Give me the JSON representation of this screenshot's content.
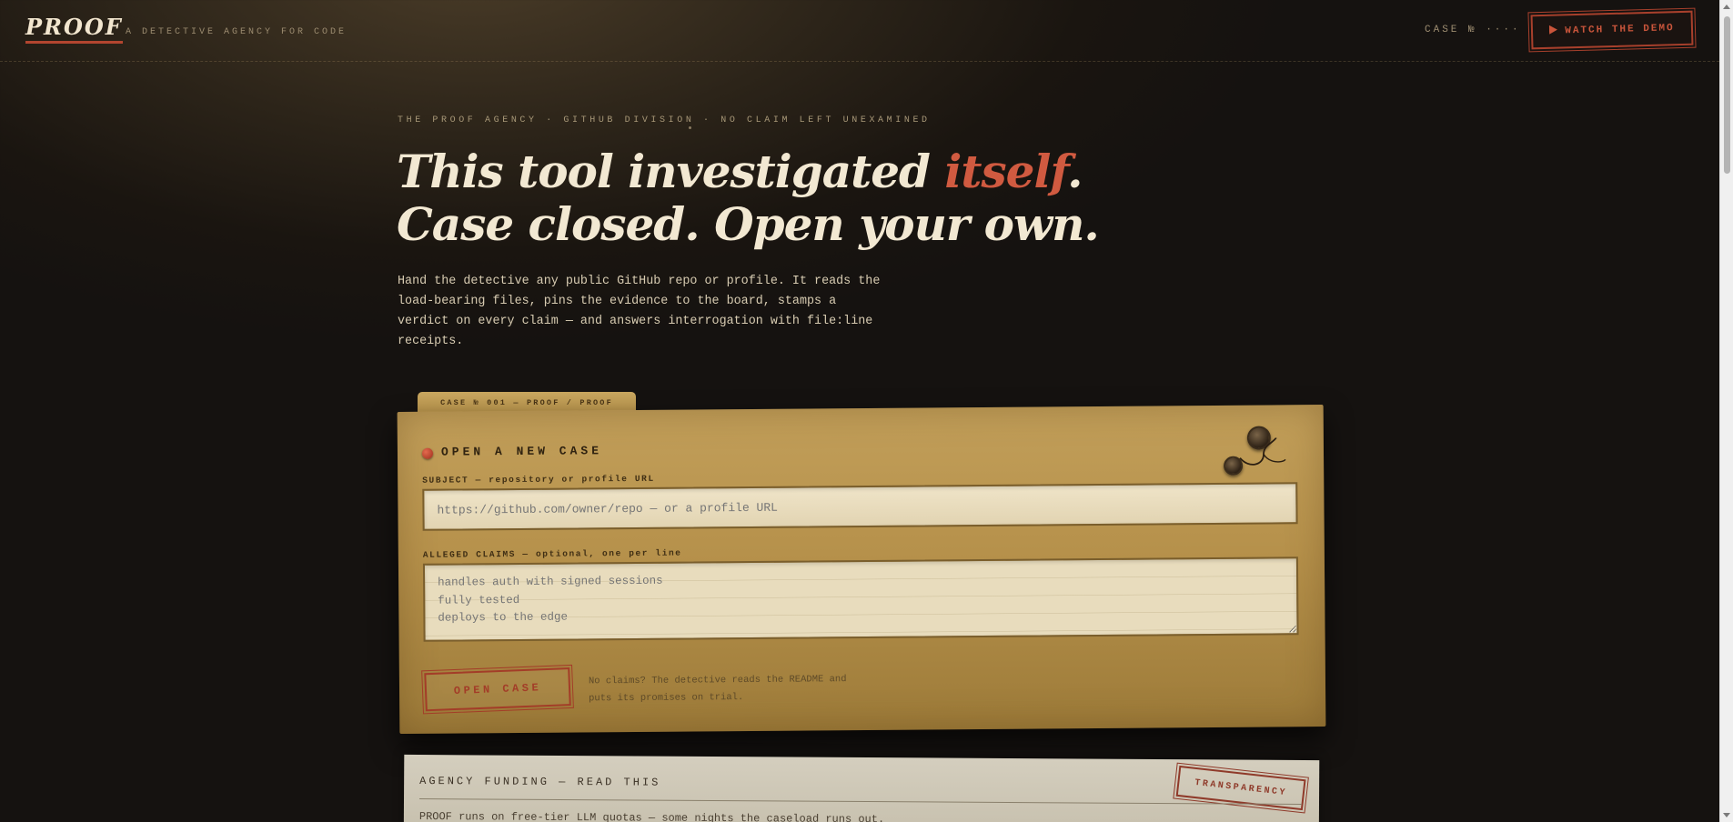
{
  "header": {
    "logo": "PROOF",
    "tagline": "A DETECTIVE AGENCY FOR CODE",
    "case_label": "CASE № ····",
    "demo_button": "WATCH THE DEMO",
    "demo_icon": "play-icon"
  },
  "hero": {
    "kicker": "THE PROOF AGENCY · GITHUB DIVISION · NO CLAIM LEFT UNEXAMINED",
    "headline_part1": "This tool investigated ",
    "headline_accent": "itself",
    "headline_part2": ".",
    "headline_line2": "Case closed. Open your own.",
    "lede": "Hand the detective any public GitHub repo or profile. It reads the load-bearing files, pins the evidence to the board, stamps a verdict on every claim — and answers interrogation with file:line receipts."
  },
  "case_folder": {
    "tab_label": "CASE № 001 — PROOF / PROOF",
    "title": "OPEN A NEW CASE",
    "subject_label": "SUBJECT — repository or profile URL",
    "subject_placeholder": "https://github.com/owner/repo — or a profile URL",
    "claims_label": "ALLEGED CLAIMS — optional, one per line",
    "claims_placeholder": "handles auth with signed sessions\nfully tested\ndeploys to the edge",
    "submit_button": "OPEN CASE",
    "hint": "No claims? The detective reads the README and puts its promises on trial."
  },
  "memo": {
    "title": "AGENCY FUNDING — READ THIS",
    "stamp": "TRANSPARENCY",
    "body": "PROOF runs on free-tier LLM quotas — some nights the caseload runs out."
  },
  "colors": {
    "accent": "#d05a40",
    "folder": "#b6914b",
    "background": "#1a1510"
  }
}
